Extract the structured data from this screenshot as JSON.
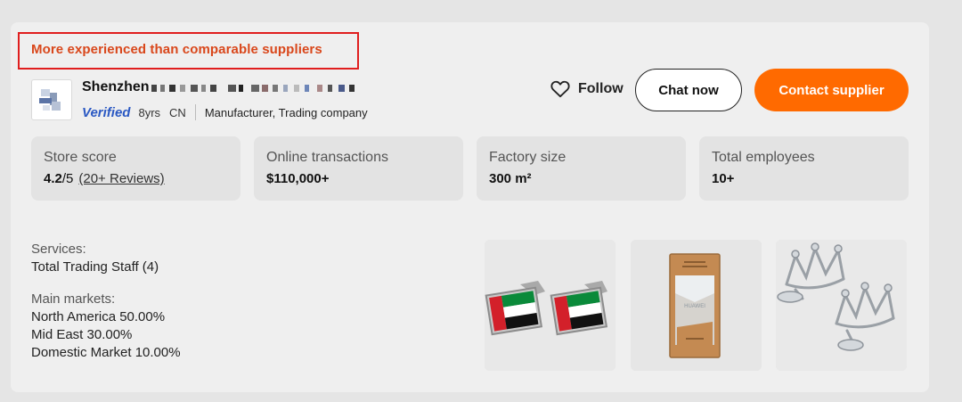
{
  "banner": {
    "tagline": "More experienced than comparable suppliers"
  },
  "supplier": {
    "name_prefix": "Shenzhen",
    "verified_label": "Verified",
    "years": "8yrs",
    "country": "CN",
    "business_type": "Manufacturer, Trading company"
  },
  "actions": {
    "follow_label": "Follow",
    "chat_label": "Chat now",
    "contact_label": "Contact supplier"
  },
  "stats": [
    {
      "label": "Store score",
      "value": "4.2",
      "suffix": "/5",
      "link": "(20+ Reviews)"
    },
    {
      "label": "Online transactions",
      "value": "$110,000+"
    },
    {
      "label": "Factory size",
      "value": "300 m²"
    },
    {
      "label": "Total employees",
      "value": "10+"
    }
  ],
  "services": {
    "heading": "Services:",
    "items": [
      "Total Trading Staff (4)"
    ]
  },
  "markets": {
    "heading": "Main markets:",
    "items": [
      "North America 50.00%",
      "Mid East 30.00%",
      "Domestic Market 10.00%"
    ]
  },
  "colors": {
    "accent": "#ff6a00",
    "tagline": "#d9471b",
    "verified": "#2b59c3",
    "highlight_border": "#e01e1e"
  },
  "products": [
    {
      "icon": "uae-flag-cufflinks-image"
    },
    {
      "icon": "wooden-crystal-trophy-image"
    },
    {
      "icon": "crown-cufflinks-image"
    }
  ]
}
